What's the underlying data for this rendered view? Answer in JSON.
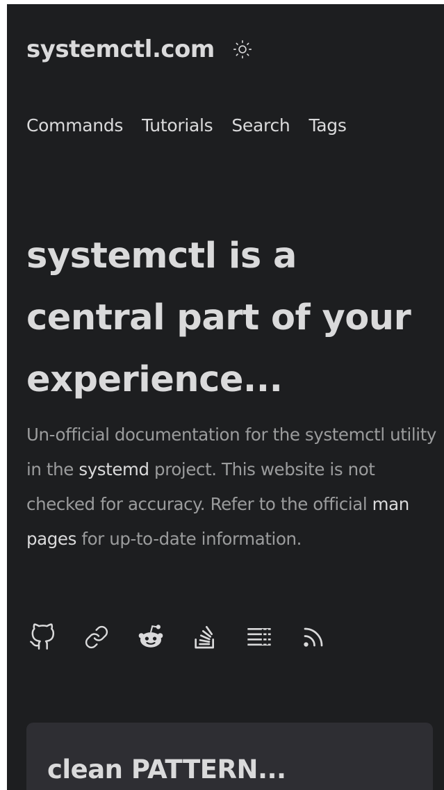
{
  "header": {
    "logo_text": "systemctl.com",
    "theme_toggle_icon": "sun-icon"
  },
  "nav": {
    "items": [
      {
        "label": "Commands"
      },
      {
        "label": "Tutorials"
      },
      {
        "label": "Search"
      },
      {
        "label": "Tags"
      }
    ]
  },
  "hero": {
    "title": "systemctl is a central part of your experience...",
    "desc_part1": "Un-official documentation for the systemctl utility in the ",
    "desc_link1": "systemd",
    "desc_part2": " project. This website is not checked for accuracy. Refer to the official ",
    "desc_link2": "man pages",
    "desc_part3": " for up-to-date information."
  },
  "social_icons": [
    "github-icon",
    "link-icon",
    "reddit-icon",
    "stackoverflow-icon",
    "list-icon",
    "rss-icon"
  ],
  "post": {
    "title": "clean PATTERN..."
  },
  "colors": {
    "background": "#1d1e20",
    "primary_text": "#dadadb",
    "secondary_text": "#9b9c9d",
    "card": "#2e2e33"
  }
}
